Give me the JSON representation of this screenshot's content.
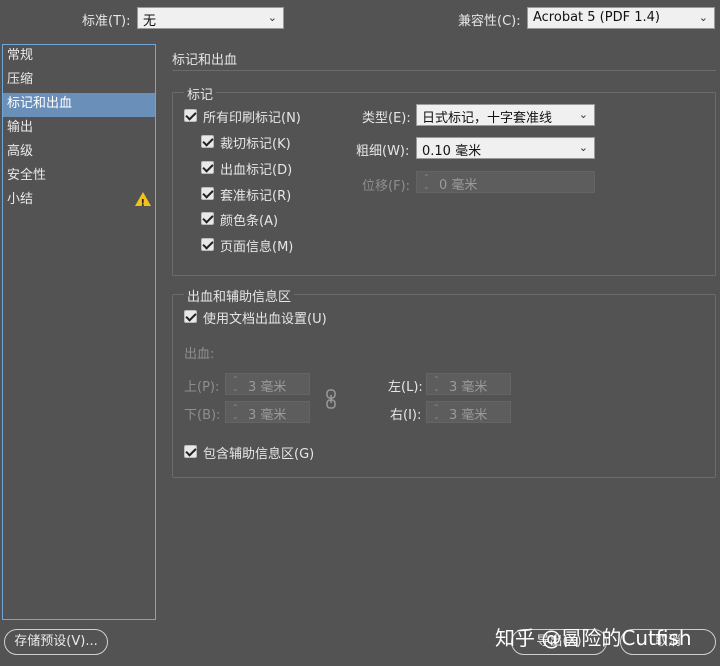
{
  "top": {
    "standard_label": "标准(T):",
    "standard_value": "无",
    "compat_label": "兼容性(C):",
    "compat_value": "Acrobat 5 (PDF 1.4)"
  },
  "sidebar": {
    "items": [
      {
        "label": "常规"
      },
      {
        "label": "压缩"
      },
      {
        "label": "标记和出血"
      },
      {
        "label": "输出"
      },
      {
        "label": "高级"
      },
      {
        "label": "安全性"
      },
      {
        "label": "小结"
      }
    ],
    "active_index": 2
  },
  "panel": {
    "title": "标记和出血",
    "marks": {
      "group_title": "标记",
      "all_marks": "所有印刷标记(N)",
      "crop": "裁切标记(K)",
      "bleed": "出血标记(D)",
      "registration": "套准标记(R)",
      "color_bars": "颜色条(A)",
      "page_info": "页面信息(M)",
      "type_label": "类型(E):",
      "type_value": "日式标记，十字套准线",
      "weight_label": "粗细(W):",
      "weight_value": "0.10 毫米",
      "offset_label": "位移(F):",
      "offset_value": "0 毫米"
    },
    "bleed": {
      "group_title": "出血和辅助信息区",
      "use_doc": "使用文档出血设置(U)",
      "bleed_label": "出血:",
      "top_label": "上(P):",
      "top_value": "3 毫米",
      "bottom_label": "下(B):",
      "bottom_value": "3 毫米",
      "left_label": "左(L):",
      "left_value": "3 毫米",
      "right_label": "右(I):",
      "right_value": "3 毫米",
      "include_slug": "包含辅助信息区(G)"
    }
  },
  "footer": {
    "save_preset": "存储预设(V)...",
    "export": "导出(X)",
    "cancel": "取消"
  },
  "watermark": "知乎 @冒险的Cutfish",
  "colors": {
    "background": "#535353",
    "selection": "#6a8fb9",
    "warning": "#f2c21b"
  }
}
